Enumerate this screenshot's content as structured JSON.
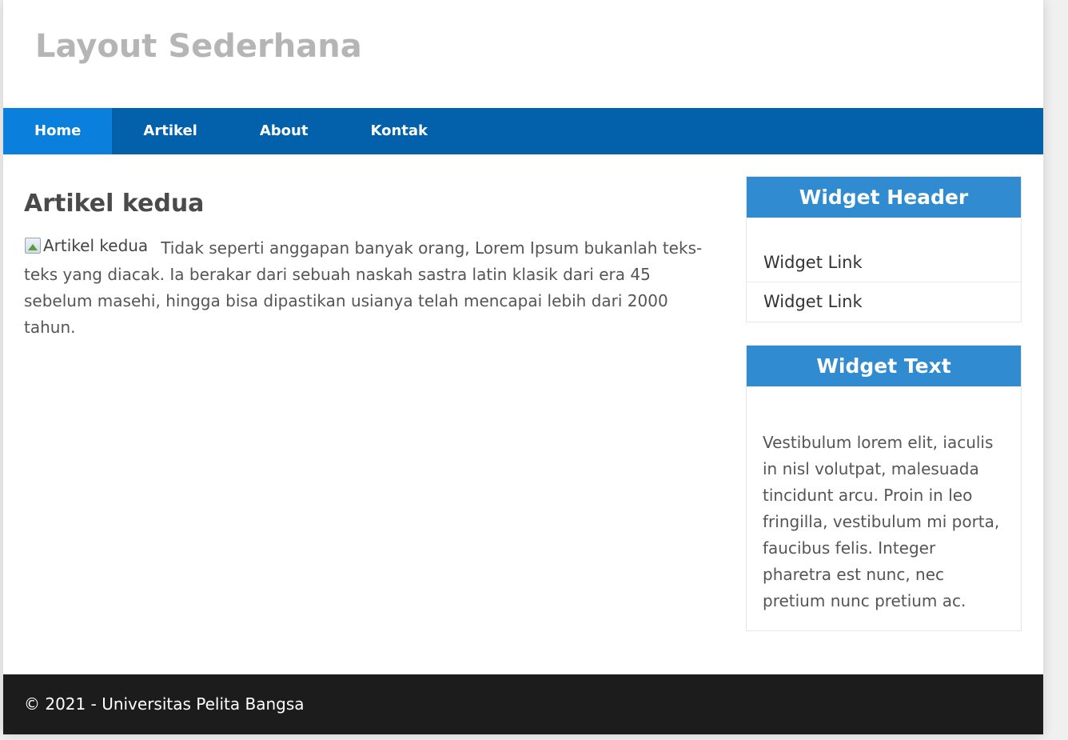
{
  "site": {
    "title": "Layout Sederhana"
  },
  "nav": {
    "items": [
      {
        "label": "Home",
        "active": true
      },
      {
        "label": "Artikel",
        "active": false
      },
      {
        "label": "About",
        "active": false
      },
      {
        "label": "Kontak",
        "active": false
      }
    ]
  },
  "article": {
    "title": "Artikel kedua",
    "image_alt": "Artikel kedua",
    "body": "Tidak seperti anggapan banyak orang, Lorem Ipsum bukanlah teks-teks yang diacak. Ia berakar dari sebuah naskah sastra latin klasik dari era 45 sebelum masehi, hingga bisa dipastikan usianya telah mencapai lebih dari 2000 tahun."
  },
  "sidebar": {
    "widget_links": {
      "header": "Widget Header",
      "links": [
        "Widget Link",
        "Widget Link"
      ]
    },
    "widget_text": {
      "header": "Widget Text",
      "text": "Vestibulum lorem elit, iaculis in nisl volutpat, malesuada tincidunt arcu. Proin in leo fringilla, vestibulum mi porta, faucibus felis. Integer pharetra est nunc, nec pretium nunc pretium ac."
    }
  },
  "footer": {
    "text": "© 2021 - Universitas Pelita Bangsa"
  },
  "colors": {
    "nav_bg": "#0361ab",
    "nav_active_bg": "#0a7fdc",
    "widget_header_bg": "#308bd0",
    "footer_bg": "#1c1c1c",
    "site_title": "#b5b5b5"
  },
  "icons": {
    "broken_image": "broken-image-icon"
  }
}
